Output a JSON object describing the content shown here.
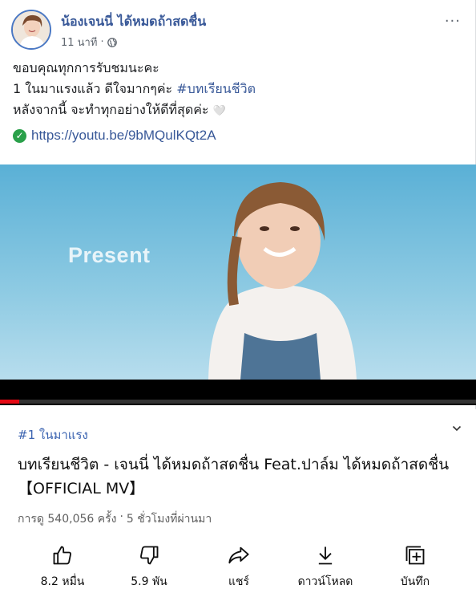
{
  "post": {
    "author": "น้องเจนนี่ ได้หมดถ้าสดชื่น",
    "timestamp": "11 นาที",
    "separator": "·",
    "more_label": "···",
    "lines": [
      "ขอบคุณทุกการรับชมนะคะ",
      "1 ในมาแรงแล้ว ดีใจมากๆค่ะ",
      "หลังจากนี้ จะทำทุกอย่างให้ดีที่สุดค่ะ"
    ],
    "hashtag": "#บทเรียนชีวิต",
    "heart_emoji": "🤍",
    "check_mark": "✓",
    "link": "https://youtu.be/9bMQulKQt2A"
  },
  "video": {
    "overlay_text": "Present",
    "progress_fraction": 0.04
  },
  "youtube": {
    "trending": "#1 ในมาแรง",
    "title": "บทเรียนชีวิต - เจนนี่ ได้หมดถ้าสดชื่น Feat.ปาล์ม ได้หมดถ้าสดชื่น【OFFICIAL MV】",
    "views": "การดู 540,056 ครั้ง",
    "dot": "·",
    "time_ago": "5 ชั่วโมงที่ผ่านมา",
    "actions": [
      {
        "label": "8.2 หมื่น",
        "icon": "like-icon"
      },
      {
        "label": "5.9 พัน",
        "icon": "dislike-icon"
      },
      {
        "label": "แชร์",
        "icon": "share-icon"
      },
      {
        "label": "ดาวน์โหลด",
        "icon": "download-icon"
      },
      {
        "label": "บันทึก",
        "icon": "save-icon"
      }
    ]
  },
  "colors": {
    "link": "#385898",
    "trend": "#3c64b1",
    "progress": "#e50914",
    "check": "#2aa04a"
  }
}
